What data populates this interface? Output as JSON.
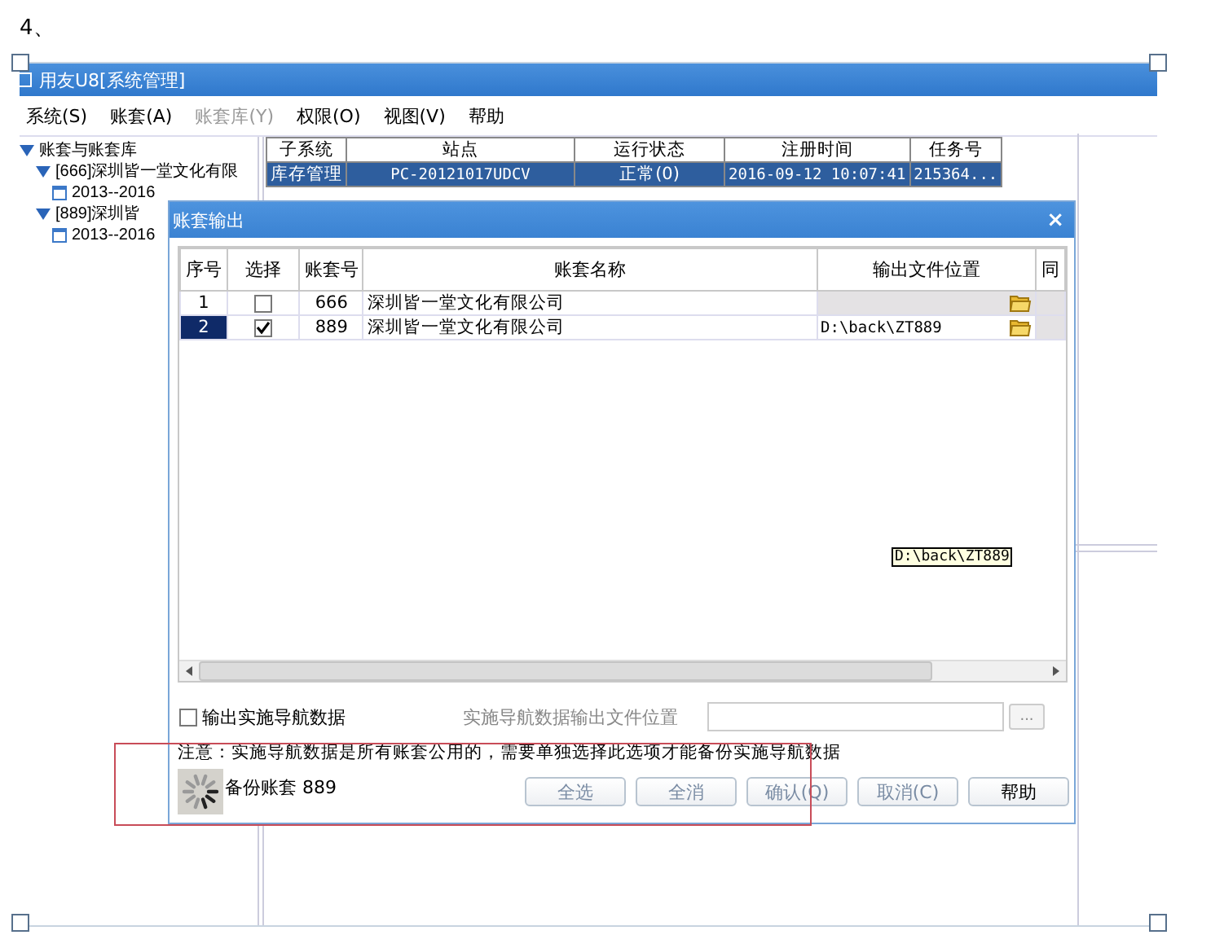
{
  "page": {
    "step": "4、"
  },
  "window": {
    "title": "用友U8[系统管理]",
    "menu": [
      {
        "label": "系统(S)",
        "disabled": false
      },
      {
        "label": "账套(A)",
        "disabled": false
      },
      {
        "label": "账套库(Y)",
        "disabled": true
      },
      {
        "label": "权限(O)",
        "disabled": false
      },
      {
        "label": "视图(V)",
        "disabled": false
      },
      {
        "label": "帮助",
        "disabled": false
      }
    ]
  },
  "tree": [
    {
      "label": "账套与账套库",
      "expanded": true,
      "children": [
        {
          "label": "[666]深圳皆一堂文化有限",
          "expanded": true,
          "children": [
            {
              "label": "2013--2016"
            }
          ]
        },
        {
          "label": "[889]深圳皆",
          "expanded": true,
          "children": [
            {
              "label": "2013--2016"
            }
          ]
        }
      ]
    }
  ],
  "table": {
    "columns": [
      "子系统",
      "站点",
      "运行状态",
      "注册时间",
      "任务号"
    ],
    "rows": [
      {
        "cells": [
          "库存管理",
          "PC-20121017UDCV",
          "正常(0)",
          "2016-09-12 10:07:41",
          "215364..."
        ],
        "selected": true
      }
    ]
  },
  "dialog": {
    "title": "账套输出",
    "close": "×",
    "columns": [
      "序号",
      "选择",
      "账套号",
      "账套名称",
      "输出文件位置",
      "同"
    ],
    "rows": [
      {
        "number": "1",
        "checked": false,
        "code": "666",
        "name": "深圳皆一堂文化有限公司",
        "selected": false
      },
      {
        "number": "2",
        "checked": true,
        "code": "889",
        "name": "深圳皆一堂文化有限公司",
        "location": "D:\\back\\ZT889",
        "selected": true
      }
    ],
    "tooltip": "D:\\back\\ZT889",
    "nav_option": {
      "label": "输出实施导航数据",
      "checked": false
    },
    "nav_path": {
      "label": "实施导航数据输出文件位置",
      "disabled": true,
      "browse": "..."
    },
    "note": "注意：实施导航数据是所有账套公用的，需要单独选择此选项才能备份实施导航数据",
    "progress": "备份账套 889",
    "buttons": [
      {
        "label": "全选",
        "disabled": true
      },
      {
        "label": "全消",
        "disabled": true
      },
      {
        "label": "确认(Q)",
        "disabled": true
      },
      {
        "label": "取消(C)",
        "disabled": true
      },
      {
        "label": "帮助",
        "disabled": false
      }
    ]
  }
}
